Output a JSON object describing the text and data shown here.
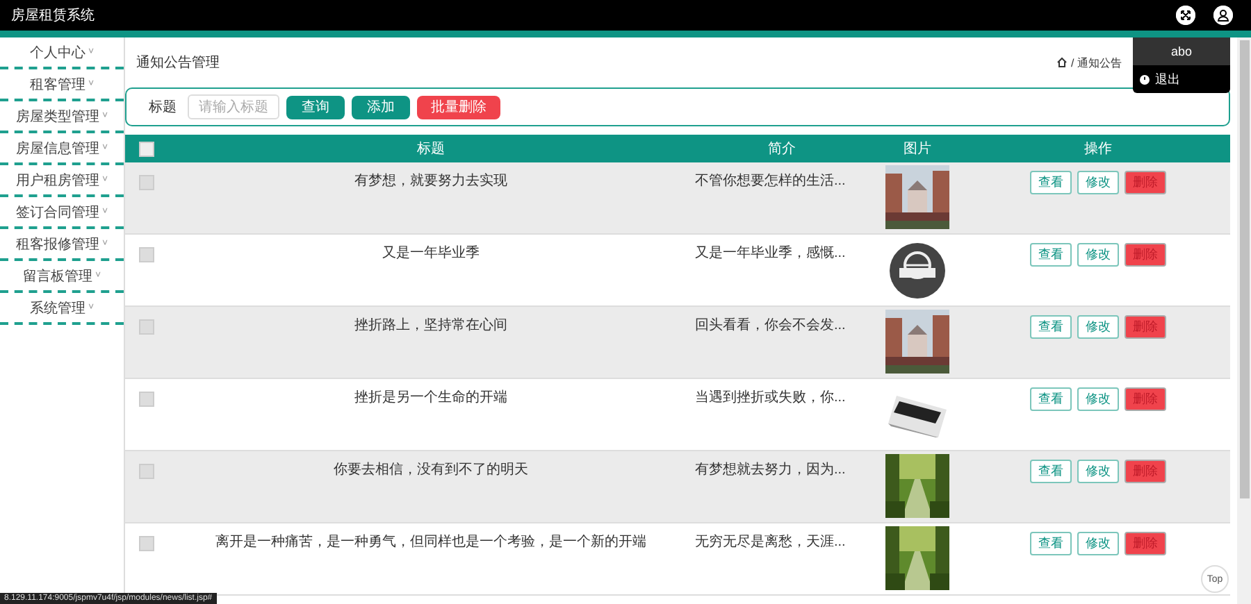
{
  "header": {
    "title": "房屋租赁系统"
  },
  "user_menu": {
    "username": "abo",
    "items": [
      "退出"
    ]
  },
  "sidebar": {
    "items": [
      {
        "label": "个人中心",
        "caret": "˅"
      },
      {
        "label": "租客管理",
        "caret": "˅"
      },
      {
        "label": "房屋类型管理",
        "caret": "˅"
      },
      {
        "label": "房屋信息管理",
        "caret": "˅"
      },
      {
        "label": "用户租房管理",
        "caret": "˅"
      },
      {
        "label": "签订合同管理",
        "caret": "˅"
      },
      {
        "label": "租客报修管理",
        "caret": "˅"
      },
      {
        "label": "留言板管理",
        "caret": "˅"
      },
      {
        "label": "系统管理",
        "caret": "˅"
      }
    ]
  },
  "page": {
    "title": "通知公告管理",
    "breadcrumb": "/ 通知公告"
  },
  "search": {
    "label": "标题",
    "placeholder": "请输入标题",
    "buttons": [
      {
        "label": "查询",
        "kind": "primary"
      },
      {
        "label": "添加",
        "kind": "primary"
      },
      {
        "label": "批量删除",
        "kind": "danger"
      }
    ]
  },
  "table": {
    "select_all": {
      "checked": false
    },
    "columns": [
      "标题",
      "简介",
      "图片",
      "操作"
    ],
    "rows": [
      {
        "checked": false,
        "title": "有梦想，就要努力去实现",
        "intro": "不管你想要怎样的生活...",
        "image": {
          "kind": "picture"
        },
        "actions": [
          "查看",
          "修改",
          "删除"
        ]
      },
      {
        "checked": false,
        "title": "又是一年毕业季",
        "intro": "又是一年毕业季，感慨...",
        "image": {
          "kind": "picture"
        },
        "actions": [
          "查看",
          "修改",
          "删除"
        ]
      },
      {
        "checked": false,
        "title": "挫折路上，坚持常在心间",
        "intro": "回头看看，你会不会发...",
        "image": {
          "kind": "picture"
        },
        "actions": [
          "查看",
          "修改",
          "删除"
        ]
      },
      {
        "checked": false,
        "title": "挫折是另一个生命的开端",
        "intro": "当遇到挫折或失败，你...",
        "image": {
          "kind": "picture"
        },
        "actions": [
          "查看",
          "修改",
          "删除"
        ]
      },
      {
        "checked": false,
        "title": "你要去相信，没有到不了的明天",
        "intro": "有梦想就去努力，因为...",
        "image": {
          "kind": "picture"
        },
        "actions": [
          "查看",
          "修改",
          "删除"
        ]
      },
      {
        "checked": false,
        "title": "离开是一种痛苦，是一种勇气，但同样也是一个考验，是一个新的开端",
        "intro": "无穷无尽是离愁，天涯...",
        "image": {
          "kind": "picture"
        },
        "actions": [
          "查看",
          "修改",
          "删除"
        ]
      }
    ]
  },
  "status_url": "8.129.11.174:9005/jspmv7u4f/jsp/modules/news/list.jsp#",
  "top_button": "Top"
}
